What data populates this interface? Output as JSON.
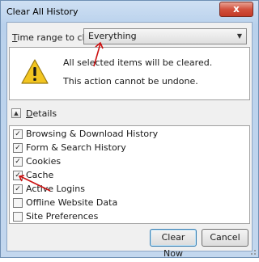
{
  "window": {
    "title": "Clear All History",
    "close_symbol": "x"
  },
  "time_range": {
    "label_prefix": "T",
    "label_rest": "ime range to clear:",
    "selected_value": "Everything"
  },
  "warning": {
    "line1": "All selected items will be cleared.",
    "line2": "This action cannot be undone."
  },
  "details": {
    "label_prefix": "D",
    "label_rest": "etails",
    "toggle_symbol": "▲"
  },
  "items": [
    {
      "label": "Browsing & Download History",
      "checked": true
    },
    {
      "label": "Form & Search History",
      "checked": true
    },
    {
      "label": "Cookies",
      "checked": true
    },
    {
      "label": "Cache",
      "checked": true
    },
    {
      "label": "Active Logins",
      "checked": true
    },
    {
      "label": "Offline Website Data",
      "checked": false
    },
    {
      "label": "Site Preferences",
      "checked": false
    }
  ],
  "buttons": {
    "clear_now": "Clear Now",
    "cancel": "Cancel"
  },
  "colors": {
    "annotation_arrow": "#cc1111",
    "warning_yellow": "#f2c521"
  }
}
